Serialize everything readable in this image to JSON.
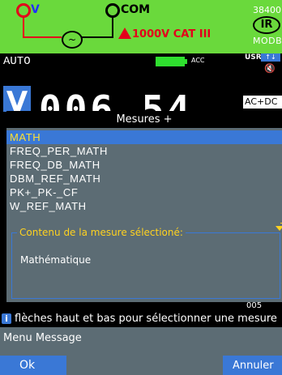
{
  "header": {
    "terminal_v": "V",
    "terminal_com": "COM",
    "ac_symbol": "~",
    "warning": "1000V CAT III",
    "serial": "38400",
    "ir_badge": "IR",
    "modbus": "MODBUS"
  },
  "status": {
    "mode": "AUTO",
    "acc_label": "ACC",
    "usr_label": "USR",
    "usr_arrows": "↑↓",
    "mute_symbol": "🔇"
  },
  "reading": {
    "unit_badge": "V",
    "value": "006.54",
    "coupling": "AC+DC"
  },
  "dialog": {
    "title": "Mesures +",
    "items": [
      {
        "label": "MATH",
        "selected": true
      },
      {
        "label": "FREQ_PER_MATH",
        "selected": false
      },
      {
        "label": "FREQ_DB_MATH",
        "selected": false
      },
      {
        "label": "DBM_REF_MATH",
        "selected": false
      },
      {
        "label": "PK+_PK-_CF",
        "selected": false
      },
      {
        "label": "W_REF_MATH",
        "selected": false
      }
    ],
    "content_legend": "Contenu de la mesure sélectioné:",
    "content_text": "Mathématique"
  },
  "under_text": "005",
  "info_bar": {
    "icon": "i",
    "text": "flèches haut et bas pour sélectionner une mesure"
  },
  "menu": {
    "title": "Menu Message",
    "ok_label": "Ok",
    "cancel_label": "Annuler"
  },
  "colors": {
    "accent": "#3a78d6",
    "header_bg": "#6ad93c",
    "panel_bg": "#5c6c74",
    "selection_text": "#ffe033",
    "legend_text": "#ffd21f",
    "warning": "#e3001b"
  }
}
